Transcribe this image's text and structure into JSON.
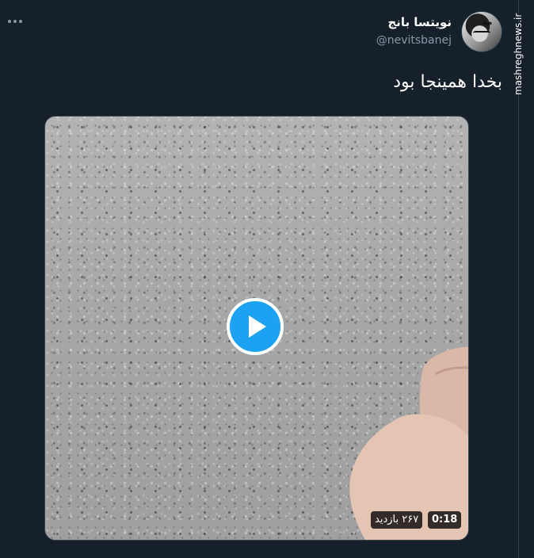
{
  "tweet": {
    "author_name": "نویتسا بانج",
    "handle": "@nevitsbanej",
    "text": "بخدا همینجا بود",
    "more_icon": "ellipsis-icon"
  },
  "watermark": {
    "text": "mashreghnews.ir"
  },
  "video": {
    "duration": "0:18",
    "views": "۲۶۷ بازدید",
    "play_icon": "play-icon",
    "accent_color": "#1da1f2"
  },
  "avatar": {
    "tag": "مه"
  }
}
